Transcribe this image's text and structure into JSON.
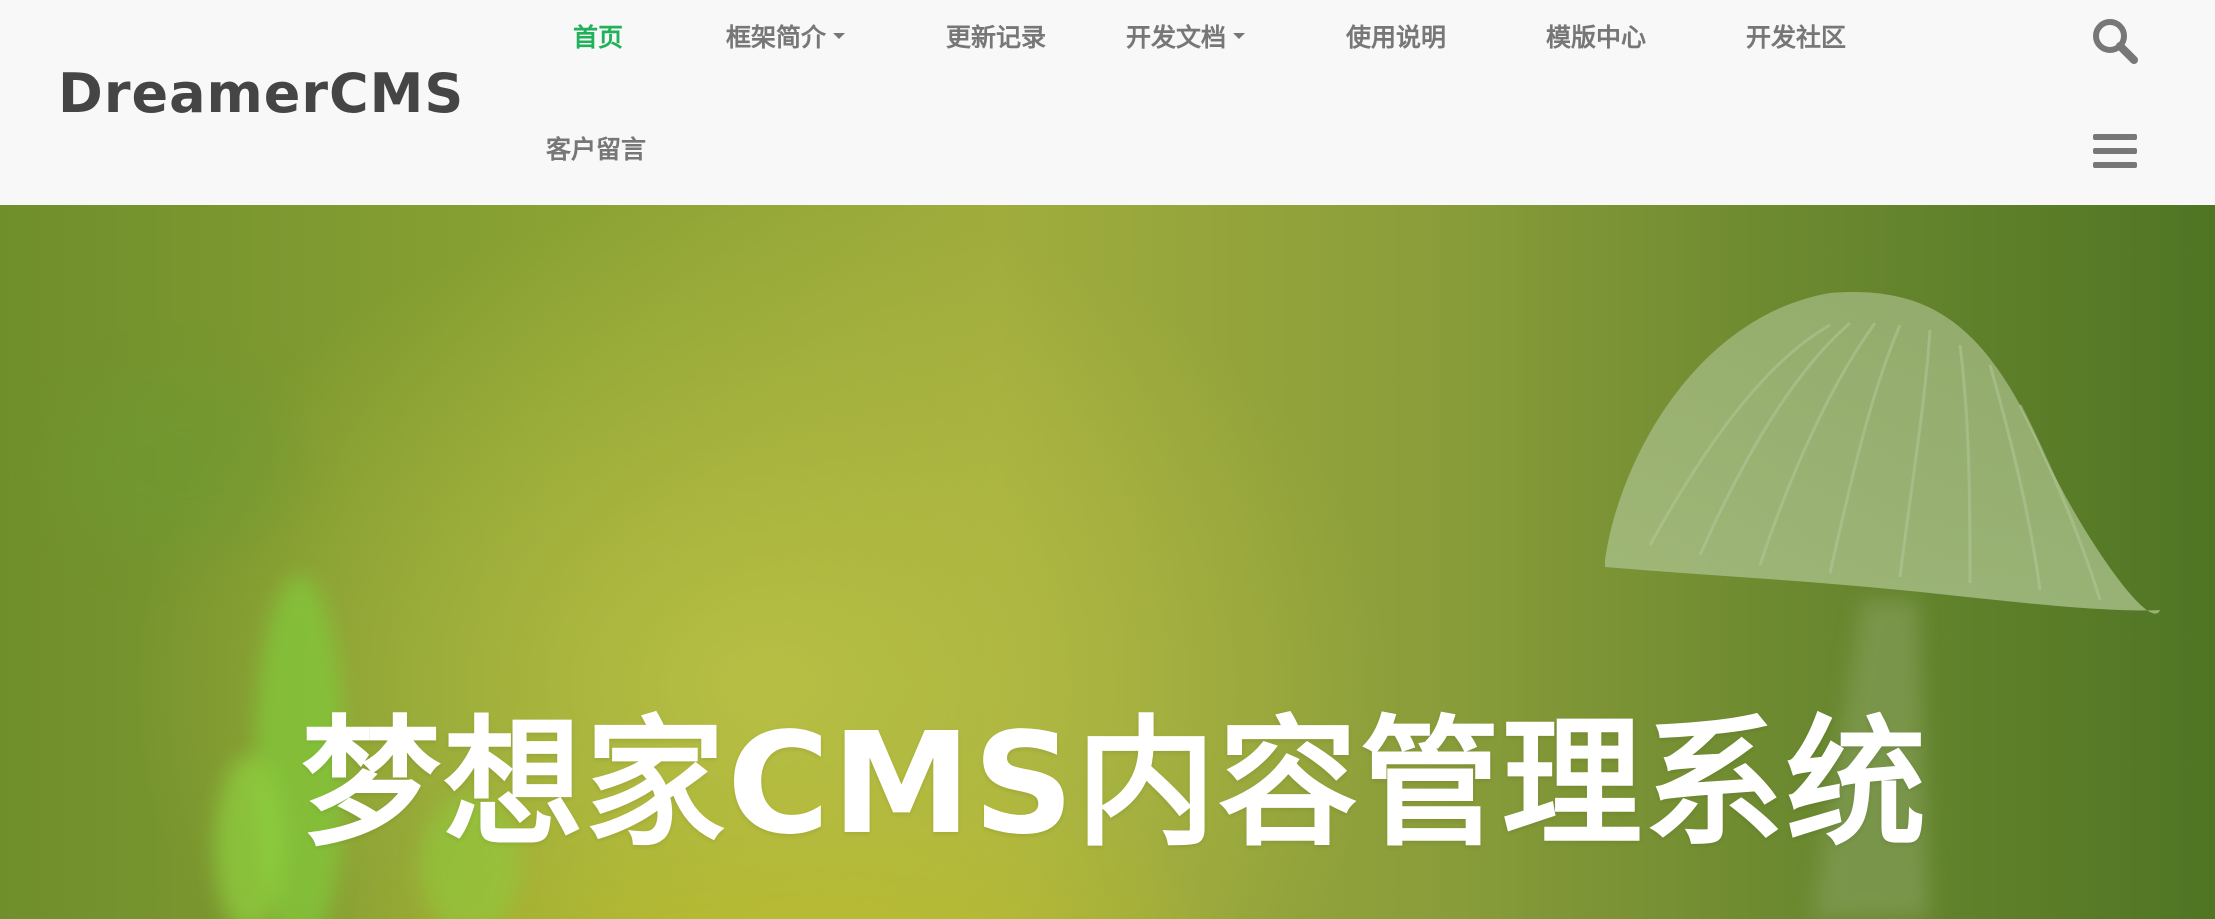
{
  "header": {
    "logo": "DreamerCMS",
    "nav": [
      {
        "label": "首页",
        "active": true,
        "has_dropdown": false
      },
      {
        "label": "框架简介",
        "active": false,
        "has_dropdown": true
      },
      {
        "label": "更新记录",
        "active": false,
        "has_dropdown": false
      },
      {
        "label": "开发文档",
        "active": false,
        "has_dropdown": true
      },
      {
        "label": "使用说明",
        "active": false,
        "has_dropdown": false
      },
      {
        "label": "模版中心",
        "active": false,
        "has_dropdown": false
      },
      {
        "label": "开发社区",
        "active": false,
        "has_dropdown": false
      },
      {
        "label": "客户留言",
        "active": false,
        "has_dropdown": false
      }
    ],
    "icons": {
      "search": "search-icon",
      "menu": "hamburger-menu-icon"
    }
  },
  "hero": {
    "title": "梦想家CMS内容管理系统",
    "background": "green-mushroom-photo"
  },
  "colors": {
    "accent": "#20b15a",
    "nav_text": "#777777",
    "logo_text": "#454545",
    "header_bg": "#f8f8f8",
    "hero_title": "#ffffff"
  }
}
